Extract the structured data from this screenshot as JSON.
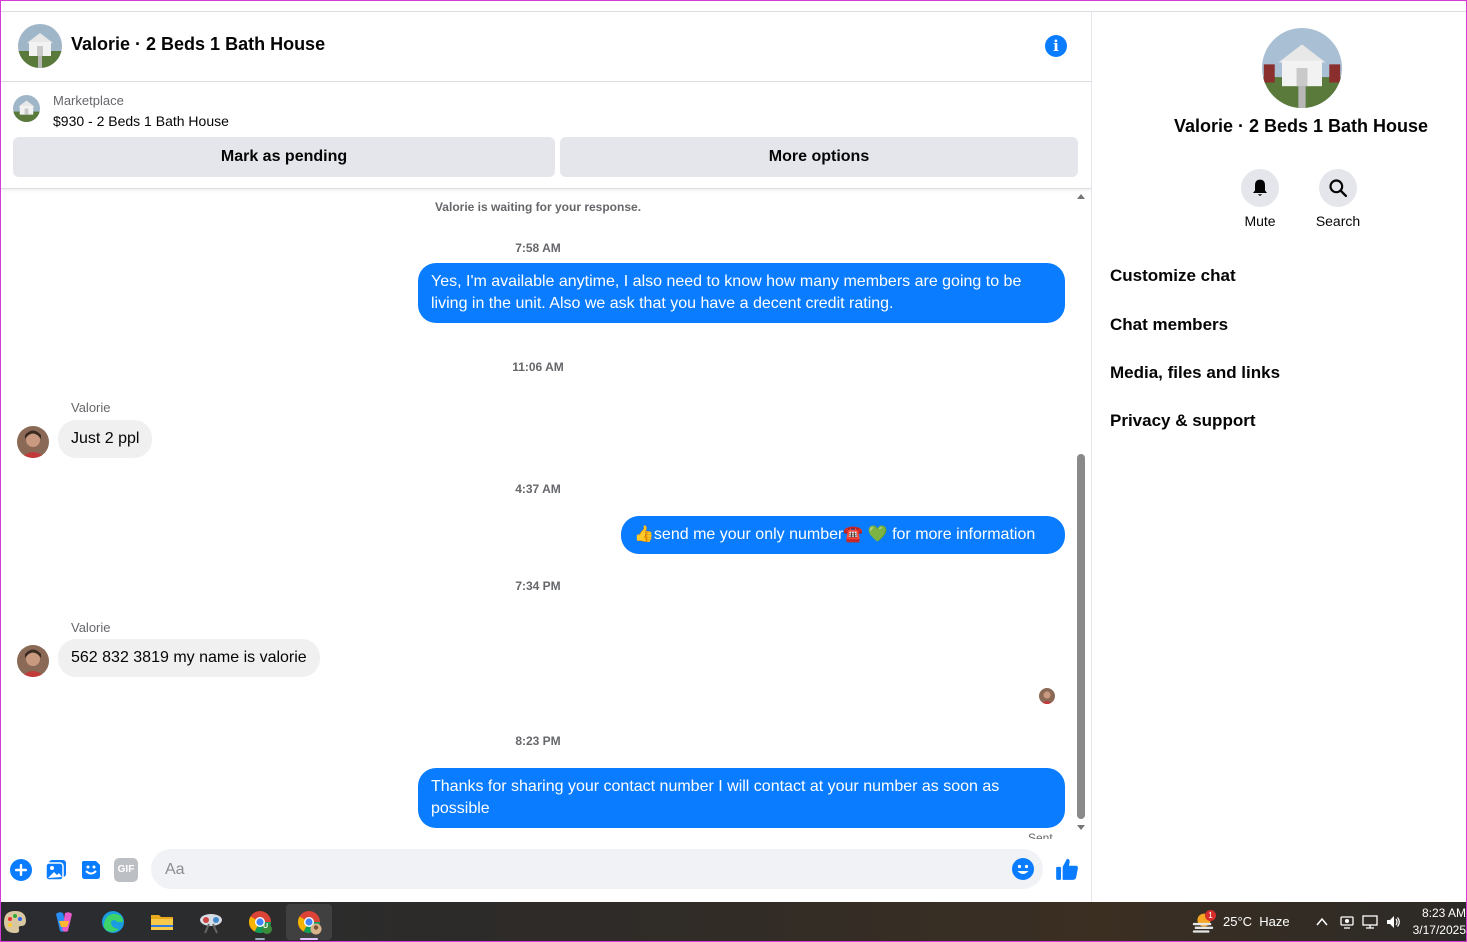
{
  "header": {
    "title": "Valorie · 2 Beds 1 Bath House"
  },
  "marketplace": {
    "label": "Marketplace",
    "listing": "$930 - 2 Beds 1 Bath House",
    "mark_pending_label": "Mark as pending",
    "more_options_label": "More options"
  },
  "messages": {
    "waiting_note": "Valorie is waiting for your response.",
    "items": [
      {
        "type": "timestamp",
        "text": "7:58 AM"
      },
      {
        "type": "outgoing",
        "text": "Yes, I'm available anytime, I also need to know how many members are going to be living in the unit. Also we ask that you have a decent credit rating."
      },
      {
        "type": "timestamp",
        "text": "11:06 AM"
      },
      {
        "type": "incoming",
        "sender": "Valorie",
        "text": "Just 2 ppl"
      },
      {
        "type": "timestamp",
        "text": "4:37 AM"
      },
      {
        "type": "outgoing",
        "text": "👍send me your only number☎️ 💚 for more information"
      },
      {
        "type": "timestamp",
        "text": "7:34 PM"
      },
      {
        "type": "incoming",
        "sender": "Valorie",
        "text": "562 832 3819 my name is valorie"
      },
      {
        "type": "timestamp",
        "text": "8:23 PM"
      },
      {
        "type": "outgoing",
        "text": "Thanks for sharing your contact number I will contact at your number as soon as possible"
      }
    ],
    "sent_label": "Sent"
  },
  "composer": {
    "placeholder": "Aa",
    "gif_label": "GIF",
    "icons": [
      "plus-circle-icon",
      "photo-gallery-icon",
      "sticker-icon",
      "gif-icon",
      "emoji-icon",
      "thumbs-up-icon"
    ]
  },
  "panel": {
    "title": "Valorie · 2 Beds 1 Bath House",
    "mute_label": "Mute",
    "search_label": "Search",
    "menu": [
      "Customize chat",
      "Chat members",
      "Media, files and links",
      "Privacy & support"
    ]
  },
  "taskbar": {
    "weather_badge": "1",
    "weather": "25°C  Haze",
    "time": "8:23 AM",
    "date": "3/17/2025",
    "chrome_badge": "U"
  },
  "colors": {
    "accent": "#0a7cff",
    "bubble_in": "#f0f0f0",
    "button_gray": "#e4e6eb"
  }
}
